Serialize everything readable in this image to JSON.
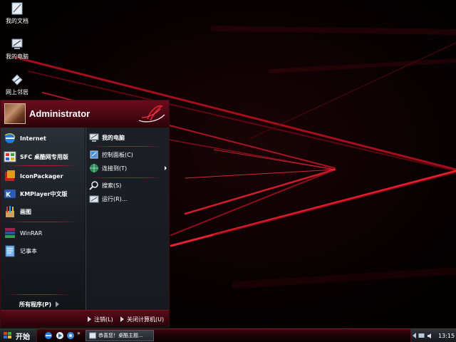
{
  "desktop": {
    "icons": [
      {
        "label": "我的文档",
        "icon": "my-documents-icon"
      },
      {
        "label": "我的电脑",
        "icon": "my-computer-icon"
      },
      {
        "label": "网上邻居",
        "icon": "network-places-icon"
      }
    ]
  },
  "start_menu": {
    "username": "Administrator",
    "pinned": [
      {
        "label": "Internet",
        "icon": "internet-explorer-icon"
      },
      {
        "label": "SFC 桌酷网专用版",
        "icon": "sfc-icon"
      }
    ],
    "recent": [
      {
        "label": "IconPackager",
        "icon": "iconpackager-icon"
      },
      {
        "label": "KMPlayer中文版",
        "icon": "kmplayer-icon"
      },
      {
        "label": "画图",
        "icon": "paint-icon"
      },
      {
        "label": "WinRAR",
        "icon": "winrar-icon"
      },
      {
        "label": "记事本",
        "icon": "notepad-icon"
      }
    ],
    "all_programs": "所有程序(P)",
    "places": [
      {
        "label": "我的电脑",
        "icon": "my-computer-icon"
      },
      {
        "label": "控制面板(C)",
        "icon": "control-panel-icon"
      },
      {
        "label": "连接到(T)",
        "icon": "connect-to-icon"
      },
      {
        "label": "搜索(S)",
        "icon": "search-icon"
      },
      {
        "label": "运行(R)...",
        "icon": "run-icon"
      }
    ],
    "footer": {
      "logoff": "注销(L)",
      "shutdown": "关闭计算机(U)"
    }
  },
  "taskbar": {
    "start_label": "开始",
    "quick_launch_more": "»",
    "task_item": "恭喜您！桌酷主题...",
    "clock": "13:15",
    "accent_color": "#b01a2d"
  }
}
